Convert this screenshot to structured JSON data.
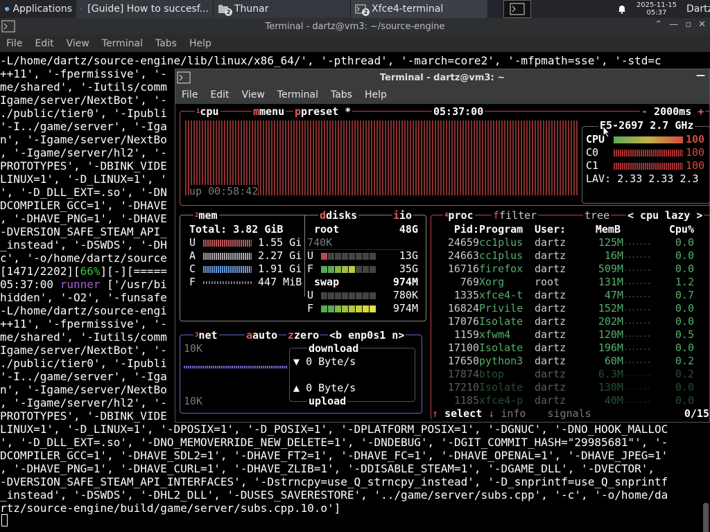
{
  "taskbar": {
    "applications_label": "Applications",
    "tasks": [
      {
        "label": "[Guide] How to succesf..."
      },
      {
        "label": "Thunar",
        "badge": "2"
      },
      {
        "label": "Xfce4-terminal",
        "badge": "2"
      }
    ],
    "clock_date": "2025-11-15",
    "clock_time": "05:37",
    "user": "Dartz"
  },
  "bg_window": {
    "title": "Terminal - dartz@vm3: ~/source-engine",
    "menu": [
      "File",
      "Edit",
      "View",
      "Terminal",
      "Tabs",
      "Help"
    ],
    "lines": [
      "-L/home/dartz/source-engine/lib/linux/x86_64/', '-pthread', '-march=core2', '-mfpmath=sse', '-std=c",
      "++11', '-fpermissive', '-",
      "me/shared', '-Iutils/comm",
      "Igame/server/NextBot', '-",
      "./public/tier0', '-Ipubli",
      "'-I../game/server', '-Iga",
      "n', '-Igame/server/NextBo",
      ", '-Igame/server/hl2', '-",
      "PROTOTYPES', '-DBINK_VIDE",
      "LINUX=1', '-D_LINUX=1', '",
      "', '-D_DLL_EXT=.so', '-DN",
      "DCOMPILER_GCC=1', '-DHAVE",
      ", '-DHAVE_PNG=1', '-DHAVE",
      "-DVERSION_SAFE_STEAM_API_",
      "_instead', '-DSWDS', '-DH",
      "c', '-o/home/dartz/source",
      "[1471/2202][66%][-][=====",
      "05:37:00 runner ['/usr/bi",
      "hidden', '-O2', '-funsafe",
      "-L/home/dartz/source-engi",
      "++11', '-fpermissive', '-",
      "me/shared', '-Iutils/comm",
      "Igame/server/NextBot', '-",
      "./public/tier0', '-Ipubli",
      "'-I../game/server', '-Iga",
      "n', '-Igame/server/NextBo",
      ", '-Igame/server/hl2', '-",
      "PROTOTYPES', '-DBINK_VIDE",
      "LINUX=1', '-D_LINUX=1', '-DPOSIX=1', '-D_POSIX=1', '-DPLATFORM_POSIX=1', '-DGNUC', '-DNO_HOOK_MALLOC",
      "', '-D_DLL_EXT=.so', '-DNO_MEMOVERRIDE_NEW_DELETE=1', '-DNDEBUG', '-DGIT_COMMIT_HASH=\"29985681\"', '-",
      "DCOMPILER_GCC=1', '-DHAVE_SDL2=1', '-DHAVE_FT2=1', '-DHAVE_FC=1', '-DHAVE_OPENAL=1', '-DHAVE_JPEG=1'",
      ", '-DHAVE_PNG=1', '-DHAVE_CURL=1', '-DHAVE_ZLIB=1', '-DDISABLE_STEAM=1', '-DGAME_DLL', '-DVECTOR',",
      "-DVERSION_SAFE_STEAM_API_INTERFACES', '-Dstrncpy=use_Q_strncpy_instead', '-D_snprintf=use_Q_snprintf",
      "_instead', '-DSWDS', '-DHL2_DLL', '-DUSES_SAVERESTORE', '../game/server/subs.cpp', '-c', '-o/home/da",
      "rtz/source-engine/build/game/server/subs.cpp.10.o']"
    ]
  },
  "fg_window": {
    "title": "Terminal - dartz@vm3: ~",
    "menu": [
      "File",
      "Edit",
      "View",
      "Terminal",
      "Tabs",
      "Help"
    ]
  },
  "btop": {
    "cpu_box": {
      "num": "1",
      "label": "cpu",
      "menu": "menu",
      "preset": "preset *",
      "time": "05:37:00",
      "interval": "2000ms",
      "model": "E5-2697",
      "freq": "2.7 GHz",
      "uptime": "up 00:58:42",
      "rows": [
        {
          "name": "CPU",
          "pct": "100"
        },
        {
          "name": "C0",
          "pct": "100"
        },
        {
          "name": "C1",
          "pct": "100"
        }
      ],
      "lav_label": "LAV:",
      "lav": "2.33 2.33 2.3"
    },
    "mem_box": {
      "num": "2",
      "label": "mem",
      "total_label": "Total:",
      "total": "3.82 GiB",
      "rows": [
        {
          "k": "U",
          "v": "1.55 Gi"
        },
        {
          "k": "A",
          "v": "2.27 Gi"
        },
        {
          "k": "C",
          "v": "1.91 Gi"
        },
        {
          "k": "F",
          "v": "447 MiB"
        }
      ]
    },
    "disks_box": {
      "label": "disks",
      "io": "io",
      "root_label": "root",
      "root_size": "48G",
      "root_io": "740K",
      "root_used": "13G",
      "root_free": "35G",
      "swap_label": "swap",
      "swap_size": "974M",
      "swap_used": "780K",
      "swap_free": "974M",
      "u": "U",
      "f": "F"
    },
    "net_box": {
      "num": "3",
      "label": "net",
      "auto": "auto",
      "zero": "zero",
      "iface": "<b enp0s1 n>",
      "top_scale": "10K",
      "bottom_scale": "10K",
      "download_label": "download",
      "download": "0 Byte/s",
      "upload_label": "upload",
      "upload": "0 Byte/s"
    },
    "proc_box": {
      "num": "4",
      "label": "proc",
      "filter": "filter",
      "tree": "tree",
      "sort": "< cpu lazy >",
      "headers": [
        "Pid:",
        "Program",
        "User:",
        "MemB",
        "Cpu%"
      ],
      "rows": [
        {
          "pid": "24659",
          "prog": "cc1plus",
          "user": "dartz",
          "mem": "125M",
          "cpu": "0.0"
        },
        {
          "pid": "24663",
          "prog": "cc1plus",
          "user": "dartz",
          "mem": "16M",
          "cpu": "0.0"
        },
        {
          "pid": "16716",
          "prog": "firefox",
          "user": "dartz",
          "mem": "509M",
          "cpu": "0.0"
        },
        {
          "pid": "769",
          "prog": "Xorg",
          "user": "root",
          "mem": "131M",
          "cpu": "1.2"
        },
        {
          "pid": "1335",
          "prog": "xfce4-t",
          "user": "dartz",
          "mem": "47M",
          "cpu": "0.7"
        },
        {
          "pid": "16824",
          "prog": "Privile",
          "user": "dartz",
          "mem": "152M",
          "cpu": "0.0"
        },
        {
          "pid": "17076",
          "prog": "Isolate",
          "user": "dartz",
          "mem": "202M",
          "cpu": "0.0"
        },
        {
          "pid": "1159",
          "prog": "xfwm4",
          "user": "dartz",
          "mem": "120M",
          "cpu": "0.5"
        },
        {
          "pid": "17100",
          "prog": "Isolate",
          "user": "dartz",
          "mem": "196M",
          "cpu": "0.0"
        },
        {
          "pid": "17650",
          "prog": "python3",
          "user": "dartz",
          "mem": "60M",
          "cpu": "0.2"
        },
        {
          "pid": "17874",
          "prog": "btop",
          "user": "dartz",
          "mem": "6.3M",
          "cpu": "0.2"
        },
        {
          "pid": "17210",
          "prog": "Isolate",
          "user": "dartz",
          "mem": "130M",
          "cpu": "0.0"
        },
        {
          "pid": "1185",
          "prog": "xfce4-p",
          "user": "dartz",
          "mem": "40M",
          "cpu": "0.0"
        }
      ],
      "select": "select",
      "info": "info",
      "signals": "signals",
      "count": "0/15"
    }
  }
}
